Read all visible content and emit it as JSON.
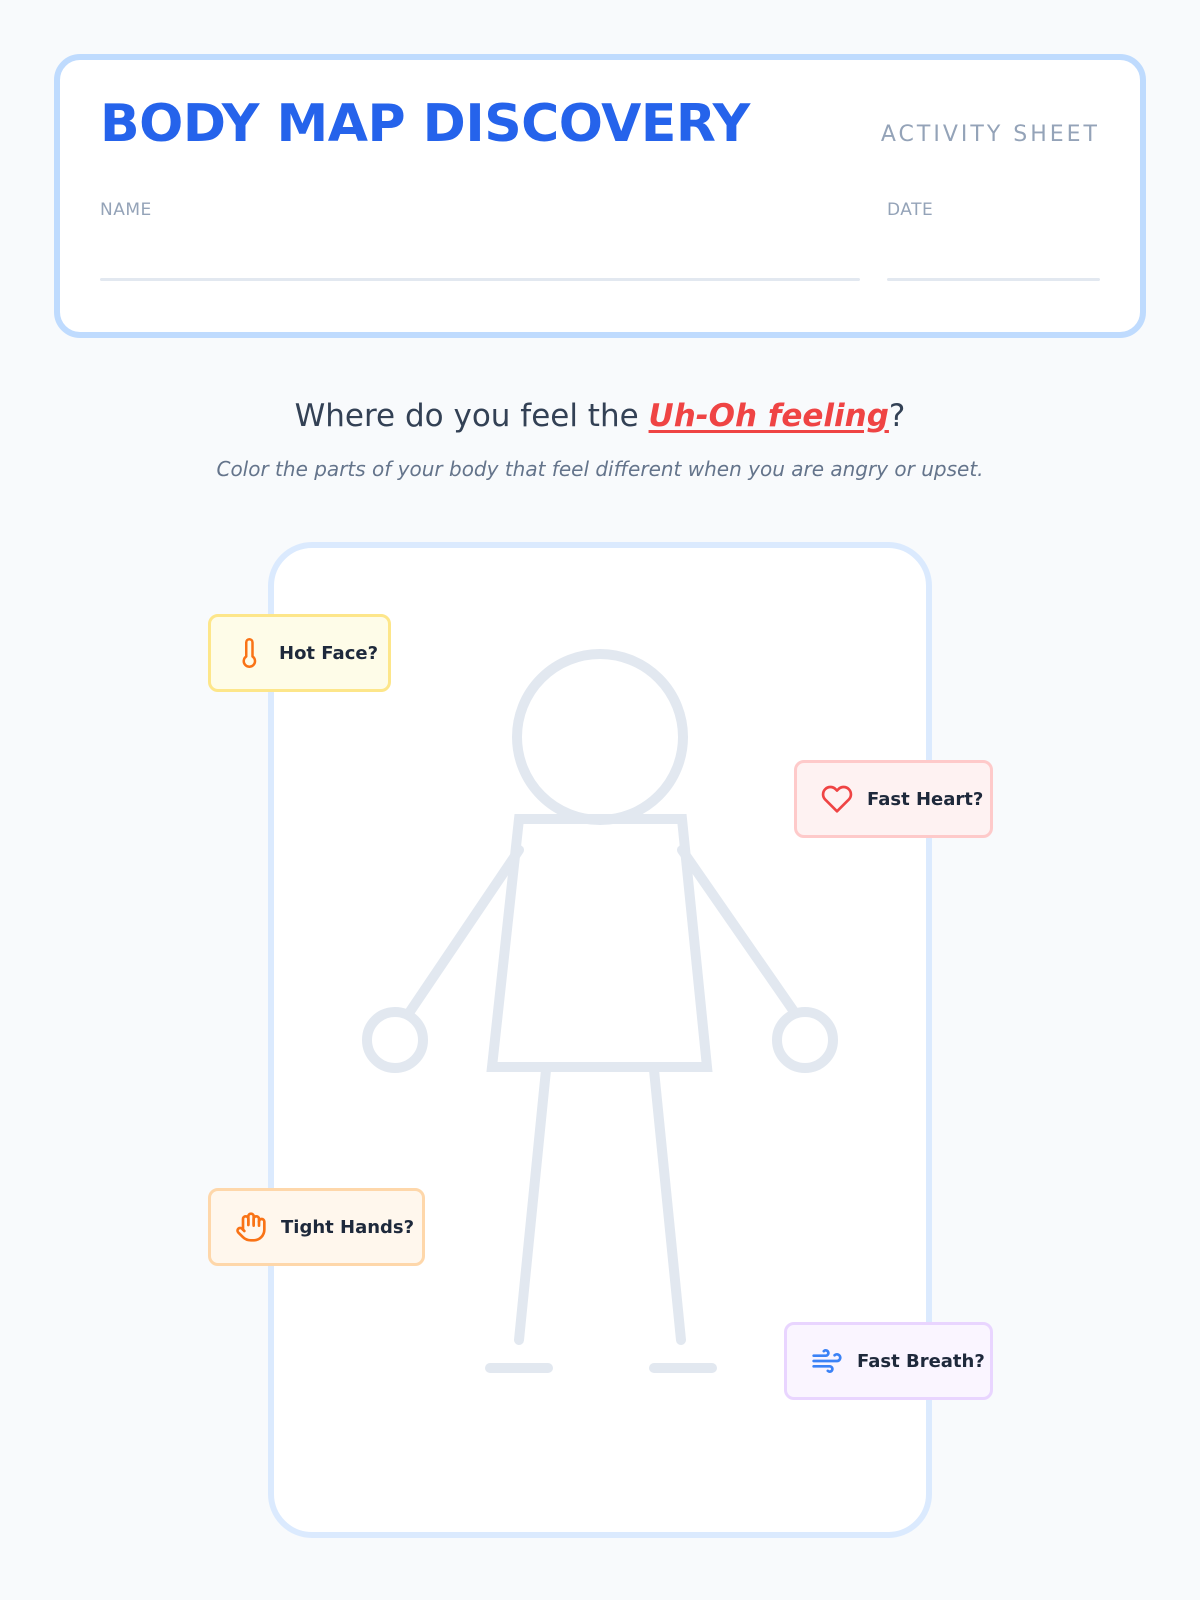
{
  "header": {
    "title": "BODY MAP DISCOVERY",
    "subtitle": "ACTIVITY SHEET",
    "name_label": "NAME",
    "date_label": "DATE"
  },
  "prompt": {
    "question_before": "Where do you feel the ",
    "question_highlight": "Uh-Oh feeling",
    "question_after": "?",
    "instruction": "Color the parts of your body that feel different when you are angry or upset."
  },
  "labels": [
    {
      "text": "Hot Face?",
      "icon": "thermometer-icon"
    },
    {
      "text": "Fast Heart?",
      "icon": "heart-icon"
    },
    {
      "text": "Tight Hands?",
      "icon": "hand-icon"
    },
    {
      "text": "Fast Breath?",
      "icon": "wind-icon"
    }
  ],
  "colors": {
    "accent": "#2563eb",
    "highlight": "#ef4444",
    "figure_stroke": "#e2e8f0",
    "card_border": "#bfdbfe"
  }
}
